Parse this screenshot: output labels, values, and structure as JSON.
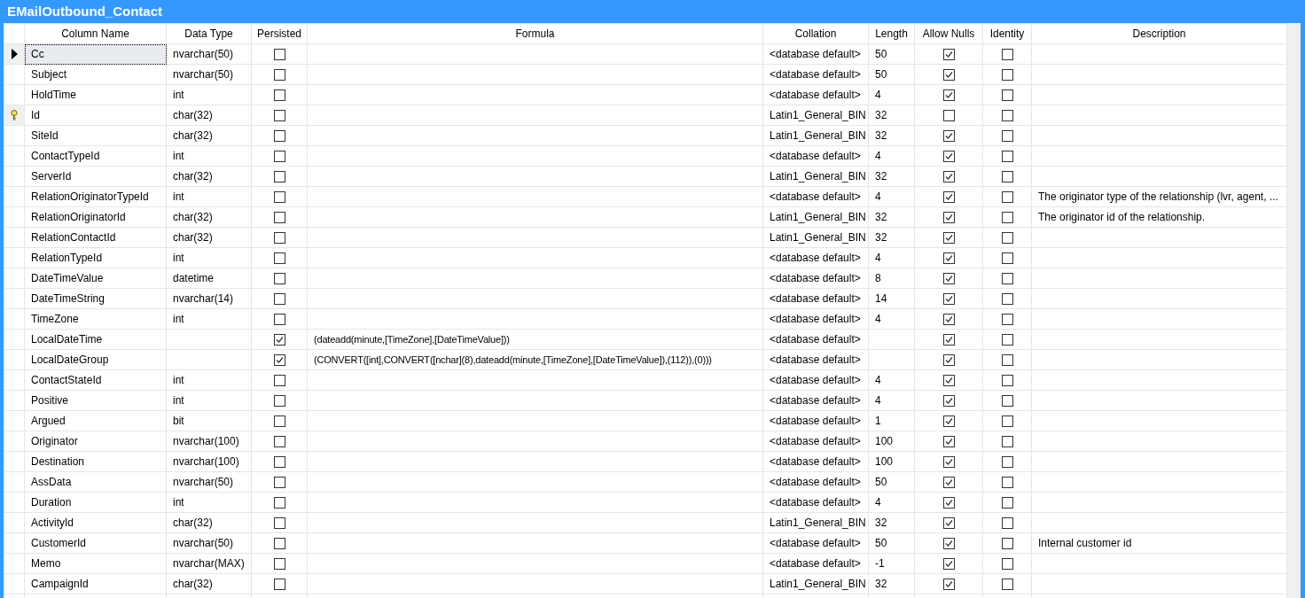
{
  "window": {
    "title": "EMailOutbound_Contact"
  },
  "table": {
    "columns": [
      "Column Name",
      "Data Type",
      "Persisted",
      "Formula",
      "Collation",
      "Length",
      "Allow Nulls",
      "Identity",
      "Description"
    ],
    "rows": [
      {
        "current": true,
        "primary_key": false,
        "name": "Cc",
        "data_type": "nvarchar(50)",
        "persisted": false,
        "formula": "",
        "collation": "<database default>",
        "length": "50",
        "allow_nulls": true,
        "identity": false,
        "description": ""
      },
      {
        "current": false,
        "primary_key": false,
        "name": "Subject",
        "data_type": "nvarchar(50)",
        "persisted": false,
        "formula": "",
        "collation": "<database default>",
        "length": "50",
        "allow_nulls": true,
        "identity": false,
        "description": ""
      },
      {
        "current": false,
        "primary_key": false,
        "name": "HoldTime",
        "data_type": "int",
        "persisted": false,
        "formula": "",
        "collation": "<database default>",
        "length": "4",
        "allow_nulls": true,
        "identity": false,
        "description": ""
      },
      {
        "current": false,
        "primary_key": true,
        "name": "Id",
        "data_type": "char(32)",
        "persisted": false,
        "formula": "",
        "collation": "Latin1_General_BIN",
        "length": "32",
        "allow_nulls": false,
        "identity": false,
        "description": ""
      },
      {
        "current": false,
        "primary_key": false,
        "name": "SiteId",
        "data_type": "char(32)",
        "persisted": false,
        "formula": "",
        "collation": "Latin1_General_BIN",
        "length": "32",
        "allow_nulls": true,
        "identity": false,
        "description": ""
      },
      {
        "current": false,
        "primary_key": false,
        "name": "ContactTypeId",
        "data_type": "int",
        "persisted": false,
        "formula": "",
        "collation": "<database default>",
        "length": "4",
        "allow_nulls": true,
        "identity": false,
        "description": ""
      },
      {
        "current": false,
        "primary_key": false,
        "name": "ServerId",
        "data_type": "char(32)",
        "persisted": false,
        "formula": "",
        "collation": "Latin1_General_BIN",
        "length": "32",
        "allow_nulls": true,
        "identity": false,
        "description": ""
      },
      {
        "current": false,
        "primary_key": false,
        "name": "RelationOriginatorTypeId",
        "data_type": "int",
        "persisted": false,
        "formula": "",
        "collation": "<database default>",
        "length": "4",
        "allow_nulls": true,
        "identity": false,
        "description": "The originator type of the relationship (lvr, agent, ..."
      },
      {
        "current": false,
        "primary_key": false,
        "name": "RelationOriginatorId",
        "data_type": "char(32)",
        "persisted": false,
        "formula": "",
        "collation": "Latin1_General_BIN",
        "length": "32",
        "allow_nulls": true,
        "identity": false,
        "description": "The originator id of the relationship."
      },
      {
        "current": false,
        "primary_key": false,
        "name": "RelationContactId",
        "data_type": "char(32)",
        "persisted": false,
        "formula": "",
        "collation": "Latin1_General_BIN",
        "length": "32",
        "allow_nulls": true,
        "identity": false,
        "description": ""
      },
      {
        "current": false,
        "primary_key": false,
        "name": "RelationTypeId",
        "data_type": "int",
        "persisted": false,
        "formula": "",
        "collation": "<database default>",
        "length": "4",
        "allow_nulls": true,
        "identity": false,
        "description": ""
      },
      {
        "current": false,
        "primary_key": false,
        "name": "DateTimeValue",
        "data_type": "datetime",
        "persisted": false,
        "formula": "",
        "collation": "<database default>",
        "length": "8",
        "allow_nulls": true,
        "identity": false,
        "description": ""
      },
      {
        "current": false,
        "primary_key": false,
        "name": "DateTimeString",
        "data_type": "nvarchar(14)",
        "persisted": false,
        "formula": "",
        "collation": "<database default>",
        "length": "14",
        "allow_nulls": true,
        "identity": false,
        "description": ""
      },
      {
        "current": false,
        "primary_key": false,
        "name": "TimeZone",
        "data_type": "int",
        "persisted": false,
        "formula": "",
        "collation": "<database default>",
        "length": "4",
        "allow_nulls": true,
        "identity": false,
        "description": ""
      },
      {
        "current": false,
        "primary_key": false,
        "name": "LocalDateTime",
        "data_type": "",
        "persisted": true,
        "formula": "(dateadd(minute,[TimeZone],[DateTimeValue]))",
        "collation": "<database default>",
        "length": "",
        "allow_nulls": true,
        "identity": false,
        "description": ""
      },
      {
        "current": false,
        "primary_key": false,
        "name": "LocalDateGroup",
        "data_type": "",
        "persisted": true,
        "formula": "(CONVERT([int],CONVERT([nchar](8),dateadd(minute,[TimeZone],[DateTimeValue]),(112)),(0)))",
        "collation": "<database default>",
        "length": "",
        "allow_nulls": true,
        "identity": false,
        "description": ""
      },
      {
        "current": false,
        "primary_key": false,
        "name": "ContactStateId",
        "data_type": "int",
        "persisted": false,
        "formula": "",
        "collation": "<database default>",
        "length": "4",
        "allow_nulls": true,
        "identity": false,
        "description": ""
      },
      {
        "current": false,
        "primary_key": false,
        "name": "Positive",
        "data_type": "int",
        "persisted": false,
        "formula": "",
        "collation": "<database default>",
        "length": "4",
        "allow_nulls": true,
        "identity": false,
        "description": ""
      },
      {
        "current": false,
        "primary_key": false,
        "name": "Argued",
        "data_type": "bit",
        "persisted": false,
        "formula": "",
        "collation": "<database default>",
        "length": "1",
        "allow_nulls": true,
        "identity": false,
        "description": ""
      },
      {
        "current": false,
        "primary_key": false,
        "name": "Originator",
        "data_type": "nvarchar(100)",
        "persisted": false,
        "formula": "",
        "collation": "<database default>",
        "length": "100",
        "allow_nulls": true,
        "identity": false,
        "description": ""
      },
      {
        "current": false,
        "primary_key": false,
        "name": "Destination",
        "data_type": "nvarchar(100)",
        "persisted": false,
        "formula": "",
        "collation": "<database default>",
        "length": "100",
        "allow_nulls": true,
        "identity": false,
        "description": ""
      },
      {
        "current": false,
        "primary_key": false,
        "name": "AssData",
        "data_type": "nvarchar(50)",
        "persisted": false,
        "formula": "",
        "collation": "<database default>",
        "length": "50",
        "allow_nulls": true,
        "identity": false,
        "description": ""
      },
      {
        "current": false,
        "primary_key": false,
        "name": "Duration",
        "data_type": "int",
        "persisted": false,
        "formula": "",
        "collation": "<database default>",
        "length": "4",
        "allow_nulls": true,
        "identity": false,
        "description": ""
      },
      {
        "current": false,
        "primary_key": false,
        "name": "ActivityId",
        "data_type": "char(32)",
        "persisted": false,
        "formula": "",
        "collation": "Latin1_General_BIN",
        "length": "32",
        "allow_nulls": true,
        "identity": false,
        "description": ""
      },
      {
        "current": false,
        "primary_key": false,
        "name": "CustomerId",
        "data_type": "nvarchar(50)",
        "persisted": false,
        "formula": "",
        "collation": "<database default>",
        "length": "50",
        "allow_nulls": true,
        "identity": false,
        "description": "Internal customer id"
      },
      {
        "current": false,
        "primary_key": false,
        "name": "Memo",
        "data_type": "nvarchar(MAX)",
        "persisted": false,
        "formula": "",
        "collation": "<database default>",
        "length": "-1",
        "allow_nulls": true,
        "identity": false,
        "description": ""
      },
      {
        "current": false,
        "primary_key": false,
        "name": "CampaignId",
        "data_type": "char(32)",
        "persisted": false,
        "formula": "",
        "collation": "Latin1_General_BIN",
        "length": "32",
        "allow_nulls": true,
        "identity": false,
        "description": ""
      }
    ]
  }
}
